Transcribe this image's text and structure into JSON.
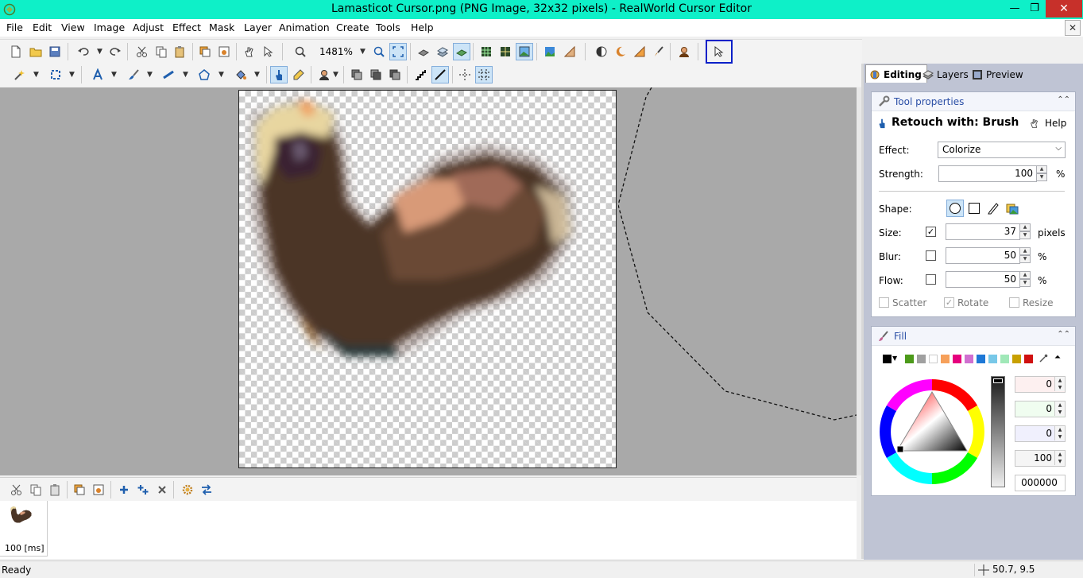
{
  "window": {
    "title": "Lamasticot Cursor.png (PNG Image, 32x32 pixels) - RealWorld Cursor Editor",
    "minimize": "—",
    "maximize": "❐",
    "close": "✕"
  },
  "menubar": {
    "items": [
      "File",
      "Edit",
      "View",
      "Image",
      "Adjust",
      "Effect",
      "Mask",
      "Layer",
      "Animation",
      "Create",
      "Tools",
      "Help"
    ],
    "mdi_close": "✕"
  },
  "toolbar": {
    "zoom": "1481%"
  },
  "frames": {
    "label": "100 [ms]"
  },
  "status": {
    "text": "Ready",
    "coords": "50.7, 9.5"
  },
  "right_panel": {
    "tabs": [
      "Editing",
      "Layers",
      "Preview"
    ],
    "active_tab": "Editing",
    "tool_properties": {
      "title": "Tool properties",
      "tool_name": "Retouch with: Brush",
      "help": "Help",
      "effect_label": "Effect:",
      "effect_value": "Colorize",
      "strength_label": "Strength:",
      "strength_value": "100",
      "strength_unit": "%",
      "shape_label": "Shape:",
      "size_label": "Size:",
      "size_value": "37",
      "size_unit": "pixels",
      "size_checked": true,
      "blur_label": "Blur:",
      "blur_value": "50",
      "blur_unit": "%",
      "blur_checked": false,
      "flow_label": "Flow:",
      "flow_value": "50",
      "flow_unit": "%",
      "flow_checked": false,
      "scatter_label": "Scatter",
      "scatter_checked": false,
      "rotate_label": "Rotate",
      "rotate_checked": true,
      "resize_label": "Resize",
      "resize_checked": false
    },
    "fill": {
      "title": "Fill",
      "palette": [
        "#000000",
        "#4c9a1a",
        "#a0a0a0",
        "#ffffff",
        "#f6a05a",
        "#e6007e",
        "#d070d0",
        "#1e78d6",
        "#78c8e8",
        "#a0e8b8",
        "#c8a000",
        "#d01010"
      ],
      "r": "0",
      "g": "0",
      "b": "0",
      "alpha": "100",
      "hex": "000000"
    }
  },
  "colors": {
    "title_bar": "#0ef0c8",
    "workspace": "#a9a9a9",
    "accent_highlight": "#0b20c8"
  }
}
